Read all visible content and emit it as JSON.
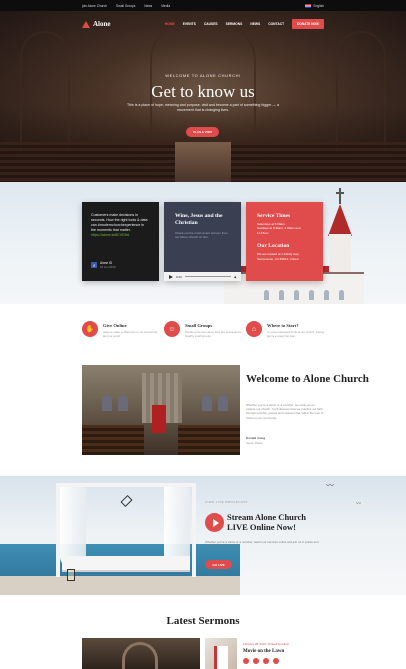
{
  "topbar": {
    "links": [
      "join Alone Church",
      "Small Groups",
      "News",
      "Media"
    ],
    "language": "English"
  },
  "nav": {
    "logo": "Alone",
    "menu": [
      "HOME",
      "EVENTS",
      "CAUSES",
      "SERMONS",
      "NEWS",
      "CONTACT"
    ],
    "active_index": 0,
    "donate": "DONATE NOW"
  },
  "hero": {
    "eyebrow": "WELCOME TO ALONE CHURCH!",
    "title": "Get to know us",
    "subtitle": "This is a place of hope, meaning and purpose. visit and become a part of something bigger — a movement that is changing lives.",
    "button": "PLAN A VISIT"
  },
  "cards": {
    "quote": {
      "lead": "Customers make decisions in seconds. How the right tools & data can ",
      "mid": "#modernchurchexperience",
      "tail": " in the moments that matter.",
      "link": "https://alone.is/8CVD9d",
      "author": "Alone ID",
      "date": "10 Jun 2019"
    },
    "audio": {
      "title": "Wine, Jesus and the Christian",
      "desc": "Check out the most recent sermon from our Alone Church on line.",
      "time": "0:00"
    },
    "service": {
      "title": "Service Times",
      "times": "Saturdays at 5:30am\nSundays at 8:30am, 9:30am and 11:15am",
      "location_title": "Our Location",
      "location": "We are located at 1 infinity loop Sacramento, CA 95814, United"
    }
  },
  "features": [
    {
      "icon": "hands-icon",
      "title": "Give Online",
      "desc": "Help us make a difference in our community and our world."
    },
    {
      "icon": "group-icon",
      "title": "Small Groups",
      "desc": "People grow best when they are connected to healthy small groups."
    },
    {
      "icon": "church-icon",
      "title": "Where to Start?",
      "desc": "If you're interested in life at our church, joining just is a great first step."
    }
  ],
  "welcome": {
    "title": "Welcome to Alone Church",
    "text": "Whether you're a visitor or a member, we invite you to explore our church. You'll discover how we practice our faith through worship, groups and missions that reflect the love of Christ in our community.",
    "sig_name": "Donald Irving",
    "sig_role": "Senior Pastor"
  },
  "stream": {
    "eyebrow": "VIEW LIVE BROADCAST",
    "title": "Stream Alone Church LIVE Online Now!",
    "text": "Whether you're a visitor or a member, watch our services online and join us in praise and worship wherever you are.",
    "button": "GO LIVE"
  },
  "sermons": {
    "title": "Latest Sermons",
    "meta": "February 28, 2019  ·  Posted by admin",
    "item_title": "Movie on the Lawn"
  },
  "colors": {
    "accent": "#e04b4b",
    "dark": "#1b1b1b",
    "slate": "#3b3f52"
  }
}
